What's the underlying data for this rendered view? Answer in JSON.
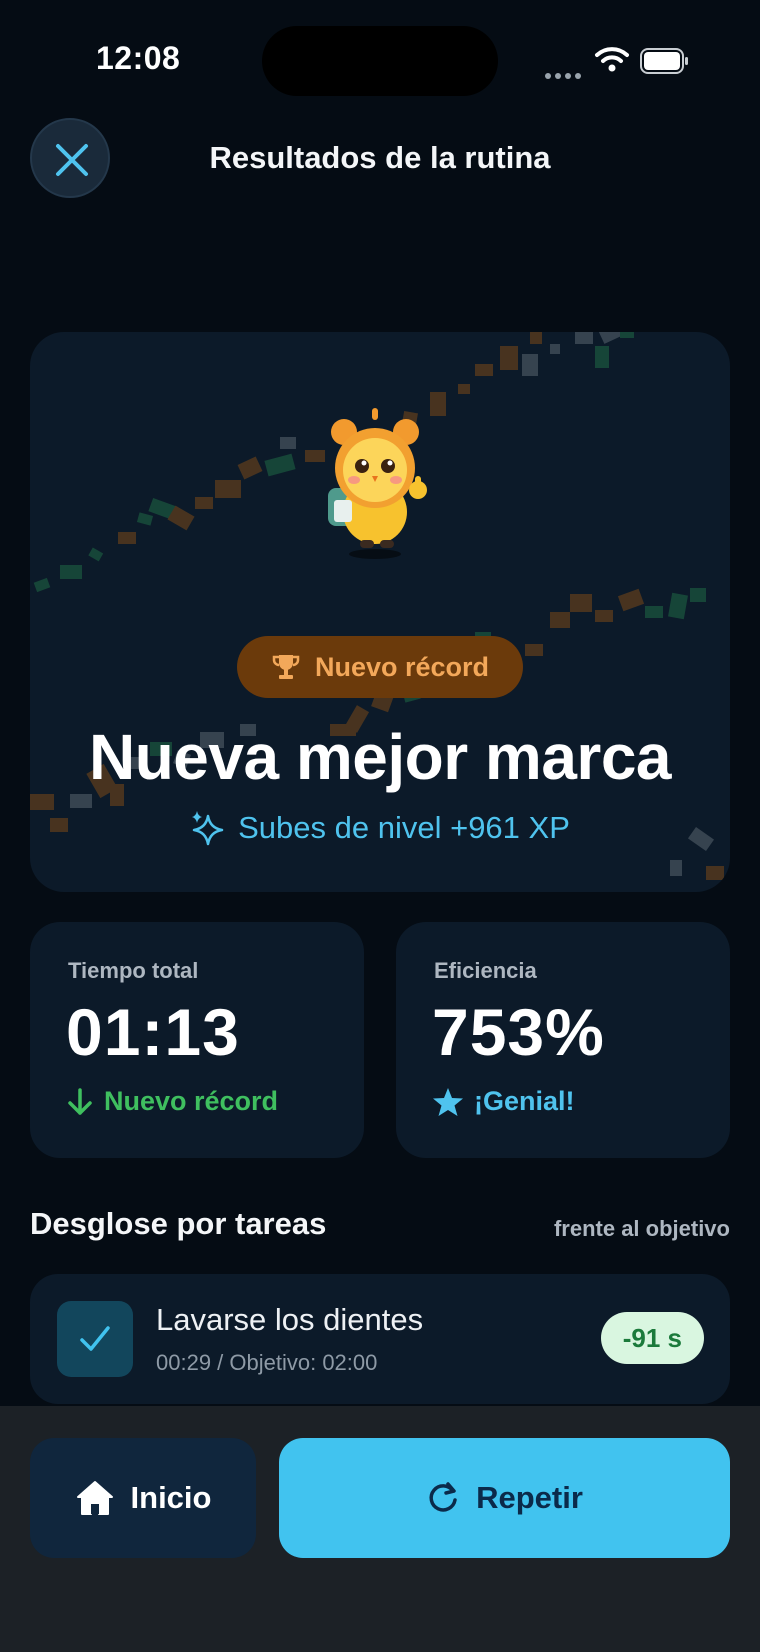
{
  "status_bar": {
    "time": "12:08"
  },
  "header": {
    "title": "Resultados de la rutina",
    "close_icon": "close-icon"
  },
  "hero": {
    "badge": "Nuevo récord",
    "badge_icon": "trophy-icon",
    "title": "Nueva mejor marca",
    "xp_text": "Subes de nivel +961 XP",
    "xp_icon": "sparkle-icon",
    "mascot": "alarm-clock-mascot"
  },
  "stats": [
    {
      "label": "Tiempo total",
      "value": "01:13",
      "sub": "Nuevo récord",
      "sub_icon": "arrow-down-icon",
      "sub_color": "#3fbf5f"
    },
    {
      "label": "Eficiencia",
      "value": "753%",
      "sub": "¡Genial!",
      "sub_icon": "star-icon",
      "sub_color": "#4fc3ee"
    }
  ],
  "breakdown": {
    "title": "Desglose por tareas",
    "hint": "frente al objetivo",
    "tasks": [
      {
        "name": "Lavarse los dientes",
        "detail": "00:29 / Objetivo: 02:00",
        "delta": "-91 s",
        "done": true
      }
    ]
  },
  "actions": {
    "home_label": "Inicio",
    "repeat_label": "Repetir"
  },
  "colors": {
    "background": "#050c14",
    "card": "#0c1a29",
    "accent": "#41c3ef",
    "record_badge": "#6b3a0b",
    "record_text": "#f3a85a",
    "success": "#3fbf5f"
  }
}
